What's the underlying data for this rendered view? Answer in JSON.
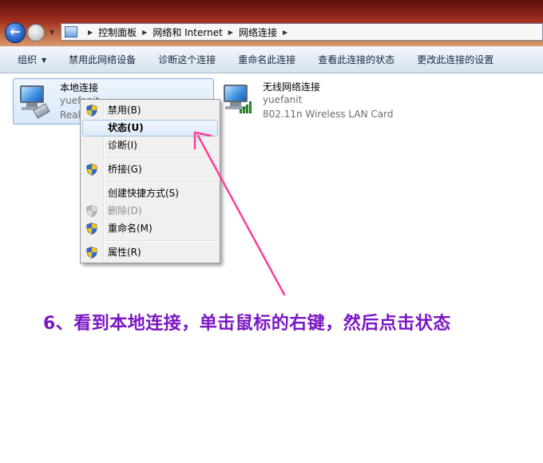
{
  "address_bar": {
    "crumbs": [
      "控制面板",
      "网络和 Internet",
      "网络连接"
    ]
  },
  "toolbar": {
    "organize": "组织",
    "disable_device": "禁用此网络设备",
    "diagnose": "诊断这个连接",
    "rename": "重命名此连接",
    "view_status": "查看此连接的状态",
    "change_settings": "更改此连接的设置"
  },
  "connections": {
    "local": {
      "name": "本地连接",
      "line1": "yuefanit",
      "line2": "Real"
    },
    "wireless": {
      "name": "无线网络连接",
      "line1": "yuefanit",
      "line2": "802.11n Wireless LAN Card"
    }
  },
  "context_menu": {
    "items": [
      {
        "label": "禁用(B)",
        "shield": true,
        "disabled": false
      },
      {
        "label": "状态(U)",
        "shield": false,
        "disabled": false,
        "highlighted": true
      },
      {
        "label": "诊断(I)",
        "shield": false,
        "disabled": false
      },
      {
        "label": "桥接(G)",
        "shield": true,
        "disabled": false
      },
      {
        "label": "创建快捷方式(S)",
        "shield": false,
        "disabled": false
      },
      {
        "label": "删除(D)",
        "shield": true,
        "disabled": true
      },
      {
        "label": "重命名(M)",
        "shield": true,
        "disabled": false
      },
      {
        "label": "属性(R)",
        "shield": true,
        "disabled": false
      }
    ]
  },
  "annotation": {
    "caption": "6、看到本地连接，单击鼠标的右键，然后点击状态",
    "caption_color": "#7b16c4",
    "arrow_color": "#ff3c9a"
  },
  "icons": {
    "back": "back-arrow-icon",
    "forward": "forward-arrow-icon",
    "shield": "uac-shield-icon",
    "wired": "wired-network-adapter-icon",
    "wireless": "wireless-network-adapter-icon"
  }
}
